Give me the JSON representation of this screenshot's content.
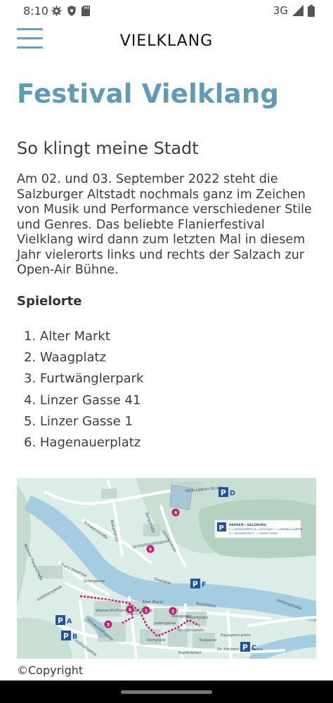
{
  "status_bar": {
    "time": "8:10",
    "network": "3G"
  },
  "header": {
    "brand": "VIELKLANG"
  },
  "article": {
    "title": "Festival Vielklang",
    "subtitle": "So klingt meine Stadt",
    "intro": "Am 02. und 03. September 2022 steht die Salzburger Altstadt nochmals ganz im Zeichen von Musik und Performance verschiedener Stile und Genres. Das beliebte Flanierfestival Vielklang wird dann zum letzten Mal in diesem Jahr vielerorts links und rechts der Salzach zur Open-Air Bühne.",
    "venues_heading": "Spielorte",
    "venues": [
      "1. Alter Markt",
      "2. Waagplatz",
      "3. Furtwänglerpark",
      "4. Linzer Gasse 41",
      "5. Linzer Gasse 1",
      "6. Hagenauerplatz"
    ]
  },
  "map": {
    "parking": [
      "A",
      "B",
      "C",
      "D",
      "F"
    ],
    "pins": [
      "1",
      "2",
      "3",
      "4",
      "5",
      "6"
    ],
    "legend": {
      "title": "PARKEN | SALZBURG",
      "lines": [
        "A = MÖNCHSBERG   B = ALTSTADT   C = MIRABELLGARTEN",
        "D = MOZARTSTEG   F = LINZER GASSE"
      ]
    },
    "streets": [
      "Paris-Lodron-Straße",
      "Schwarzstraße",
      "Makartplatz",
      "Linzer Gasse",
      "Bergstraße",
      "Franz-Josef-Kai",
      "Griesgasse",
      "Giselakai",
      "Rudolfskai",
      "Imbergstraße",
      "Universitätsplatz",
      "Alter Markt",
      "Waagplatz",
      "Mozartplatz",
      "Residenzplatz",
      "Domplatz",
      "Kapitelplatz",
      "Papageno-platz",
      "Dr.-Herbert-Klein-Gasse",
      "Wiener-Philharmoniker-Gasse",
      "Hofstallgasse",
      "Dreifaltigkeitsgasse",
      "Müllner Hauptstraße",
      "Gstättengasse",
      "Judengasse",
      "Kaigasse"
    ],
    "colors": {
      "river": "#a6cddf",
      "park": "#b7d4c4",
      "pin": "#c0206f",
      "parking": "#2154a0",
      "route": "#c0206f"
    }
  },
  "footer": {
    "copyright": "©Copyright"
  }
}
